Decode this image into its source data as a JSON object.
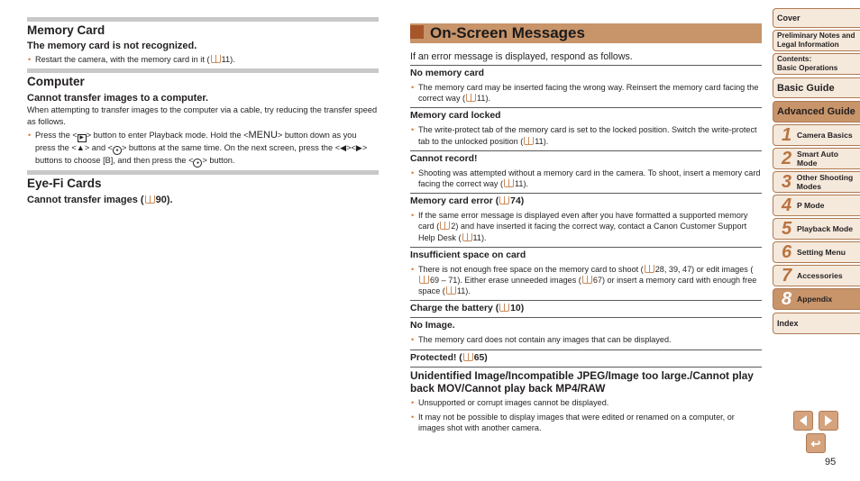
{
  "left": {
    "sections": [
      {
        "title": "Memory Card",
        "items": [
          {
            "heading": "The memory card is not recognized.",
            "bullets": [
              {
                "text": "Restart the camera, with the memory card in it (",
                "ref": "11",
                "tail": ")."
              }
            ]
          }
        ]
      },
      {
        "title": "Computer",
        "items": [
          {
            "heading": "Cannot transfer images to a computer.",
            "body": "When attempting to transfer images to the computer via a cable, try reducing the transfer speed as follows.",
            "bullet_parts": {
              "p1": "Press the <",
              "playback_icon": "playback-button-icon",
              "p2": "> button to enter Playback mode. Hold the <",
              "menu_label": "MENU",
              "p3": "> button down as you press the <",
              "up_glyph": "▲",
              "p4": "> and <",
              "func_glyph": "FUNC SET",
              "p5": "> buttons at the same time. On the next screen, press the <",
              "left_glyph": "◀",
              "p6": "><",
              "right_glyph": "▶",
              "p7": "> buttons to choose [B], and then press the <",
              "p8": "> button."
            }
          }
        ]
      },
      {
        "title": "Eye-Fi Cards",
        "items": [
          {
            "heading_pre": "Cannot transfer images (",
            "heading_ref": "90",
            "heading_post": ")."
          }
        ]
      }
    ]
  },
  "main": {
    "title": "On-Screen Messages",
    "intro": "If an error message is displayed, respond as follows.",
    "messages": [
      {
        "head": "No memory card",
        "bullets": [
          {
            "pre": "The memory card may be inserted facing the wrong way. Reinsert the memory card facing the correct way (",
            "ref": "11",
            "post": ")."
          }
        ]
      },
      {
        "head": "Memory card locked",
        "bullets": [
          {
            "pre": "The write-protect tab of the memory card is set to the locked position. Switch the write-protect tab to the unlocked position (",
            "ref": "11",
            "post": ")."
          }
        ]
      },
      {
        "head": "Cannot record!",
        "bullets": [
          {
            "pre": "Shooting was attempted without a memory card in the camera. To shoot, insert a memory card facing the correct way (",
            "ref": "11",
            "post": ")."
          }
        ]
      },
      {
        "head_pre": "Memory card error (",
        "head_ref": "74",
        "head_post": ")",
        "bullets": [
          {
            "pre": "If the same error message is displayed even after you have formatted a supported memory card (",
            "ref": "2",
            "mid": ") and have inserted it facing the correct way, contact a Canon Customer Support Help Desk (",
            "ref2": "11",
            "post": ")."
          }
        ]
      },
      {
        "head": "Insufficient space on card",
        "bullets": [
          {
            "pre": "There is not enough free space on the memory card to shoot (",
            "ref": "28, 39, 47",
            "mid": ") or edit images (",
            "ref2": "69 – 71",
            "mid2": "). Either erase unneeded images (",
            "ref3": "67",
            "mid3": ") or insert a memory card with enough free space (",
            "ref4": "11",
            "post": ")."
          }
        ]
      },
      {
        "head_pre": "Charge the battery (",
        "head_ref": "10",
        "head_post": ")"
      },
      {
        "head": "No Image.",
        "bullets": [
          {
            "pre": "The memory card does not contain any images that can be displayed."
          }
        ]
      },
      {
        "head_pre": "Protected! (",
        "head_ref": "65",
        "head_post": ")"
      },
      {
        "head": "Unidentified Image/Incompatible JPEG/Image too large./Cannot play back MOV/Cannot play back MP4/RAW",
        "bullets": [
          {
            "pre": "Unsupported or corrupt images cannot be displayed."
          },
          {
            "pre": "It may not be possible to display images that were edited or renamed on a computer, or images shot with another camera."
          }
        ]
      }
    ]
  },
  "nav": {
    "cover": "Cover",
    "prelim": "Preliminary Notes and Legal Information",
    "contents_1": "Contents:",
    "contents_2": "Basic Operations",
    "basic": "Basic Guide",
    "advanced": "Advanced Guide",
    "chapters": [
      {
        "num": "1",
        "label": "Camera Basics"
      },
      {
        "num": "2",
        "label": "Smart Auto Mode"
      },
      {
        "num": "3",
        "label": "Other Shooting Modes"
      },
      {
        "num": "4",
        "label": "P Mode"
      },
      {
        "num": "5",
        "label": "Playback Mode"
      },
      {
        "num": "6",
        "label": "Setting Menu"
      },
      {
        "num": "7",
        "label": "Accessories"
      },
      {
        "num": "8",
        "label": "Appendix"
      }
    ],
    "index": "Index",
    "return_glyph": "↩"
  },
  "page_number": "95",
  "colors": {
    "accent": "#c8946a",
    "accent_dark": "#a8552a",
    "bullet": "#d9793b",
    "rule": "#c8c8c8"
  }
}
